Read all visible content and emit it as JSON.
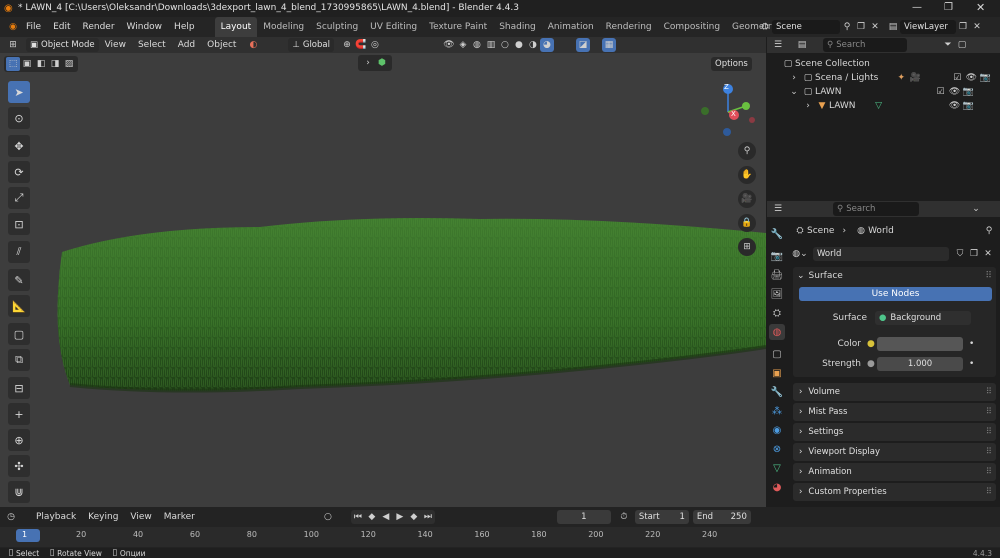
{
  "window": {
    "title": "* LAWN_4 [C:\\Users\\Oleksandr\\Downloads\\3dexport_lawn_4_blend_1730995865\\LAWN_4.blend] - Blender 4.4.3"
  },
  "menu": [
    "File",
    "Edit",
    "Render",
    "Window",
    "Help"
  ],
  "workspaces": [
    "Layout",
    "Modeling",
    "Sculpting",
    "UV Editing",
    "Texture Paint",
    "Shading",
    "Animation",
    "Rendering",
    "Compositing",
    "Geometry Node"
  ],
  "scene_name": "Scene",
  "view_layer": "ViewLayer",
  "viewport_header": {
    "mode": "Object Mode",
    "menus": [
      "View",
      "Select",
      "Add",
      "Object"
    ],
    "transform": "Global"
  },
  "options_label": "Options",
  "outliner": {
    "search_placeholder": "Search",
    "root": "Scene Collection",
    "items": [
      {
        "label": "Scena / Lights"
      },
      {
        "label": "LAWN"
      },
      {
        "label": "LAWN"
      }
    ]
  },
  "properties": {
    "search_placeholder": "Search",
    "breadcrumb": [
      "Scene",
      "World"
    ],
    "world_name": "World",
    "surface_header": "Surface",
    "use_nodes": "Use Nodes",
    "surface_label": "Surface",
    "surface_value": "Background",
    "color_label": "Color",
    "strength_label": "Strength",
    "strength_value": "1.000",
    "sections": [
      "Volume",
      "Mist Pass",
      "Settings",
      "Viewport Display",
      "Animation",
      "Custom Properties"
    ]
  },
  "timeline": {
    "menus": [
      "Playback",
      "Keying",
      "View",
      "Marker"
    ],
    "current_frame": "1",
    "start_label": "Start",
    "start_value": "1",
    "end_label": "End",
    "end_value": "250",
    "ticks": [
      "1",
      "20",
      "40",
      "60",
      "80",
      "100",
      "120",
      "140",
      "160",
      "180",
      "200",
      "220",
      "240"
    ]
  },
  "statusbar": {
    "items": [
      "Select",
      "Rotate View",
      "Опции"
    ],
    "version": "4.4.3"
  },
  "gizmo": {
    "z": "Z",
    "x": "X"
  },
  "colors": {
    "accent": "#4772b3",
    "grass_dark": "#1f4a1a",
    "grass_light": "#3d7f2c",
    "bg": "#3d3d3d"
  }
}
